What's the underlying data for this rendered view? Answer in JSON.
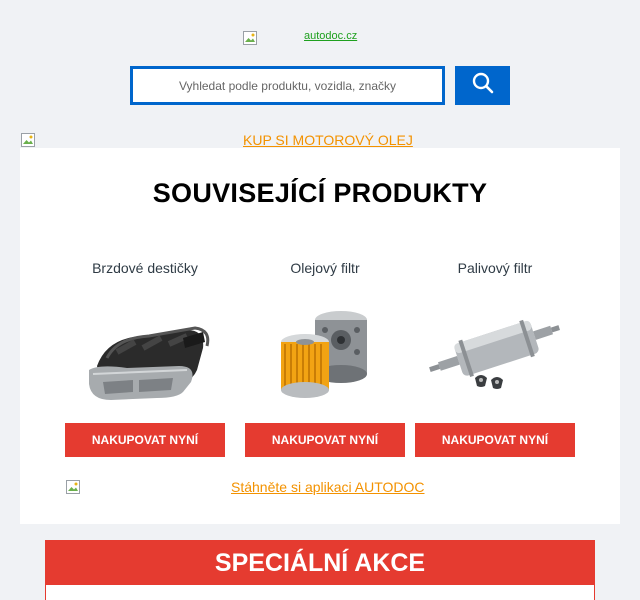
{
  "header": {
    "logo_alt": "autodoc.cz"
  },
  "search": {
    "placeholder": "Vyhledat podle produktu, vozidla, značky",
    "button_icon": "search-icon"
  },
  "banner": {
    "alt_text": "KUP SI MOTOROVÝ OLEJ"
  },
  "related": {
    "title": "SOUVISEJÍCÍ PRODUKTY",
    "products": [
      {
        "name": "Brzdové destičky",
        "button": "NAKUPOVAT NYNÍ",
        "image": "brake-pads-image"
      },
      {
        "name": "Olejový filtr",
        "button": "NAKUPOVAT NYNÍ",
        "image": "oil-filter-image"
      },
      {
        "name": "Palivový filtr",
        "button": "NAKUPOVAT NYNÍ",
        "image": "fuel-filter-image"
      }
    ],
    "app_link": "Stáhněte si aplikaci AUTODOC"
  },
  "special": {
    "title": "SPECIÁLNÍ AKCE"
  },
  "colors": {
    "accent_blue": "#0066cc",
    "button_red": "#e53b30",
    "link_orange": "#f39200",
    "logo_green": "#1ea01e"
  }
}
